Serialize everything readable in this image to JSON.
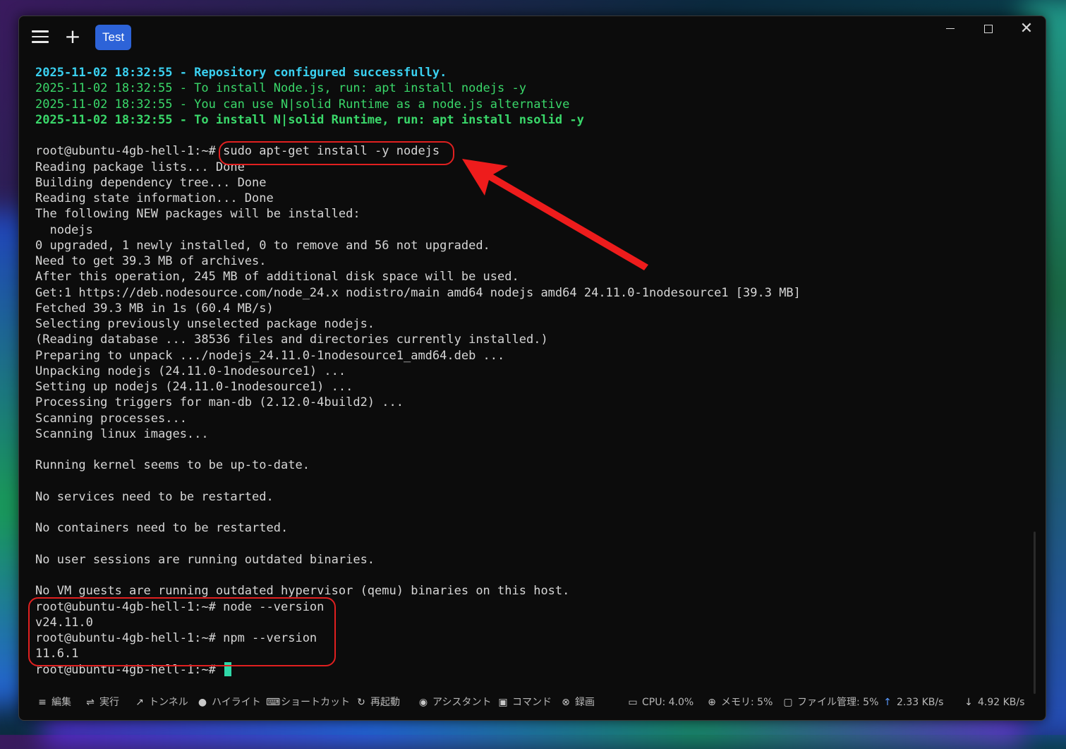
{
  "titlebar": {
    "tab_label": "Test"
  },
  "terminal": {
    "lines": [
      {
        "text": "2025-11-02 18:32:55 - Repository configured successfully.",
        "style": "c-cyan"
      },
      {
        "text": "2025-11-02 18:32:55 - To install Node.js, run: apt install nodejs -y",
        "style": "c-green"
      },
      {
        "text": "2025-11-02 18:32:55 - You can use N|solid Runtime as a node.js alternative",
        "style": "c-green"
      },
      {
        "text": "2025-11-02 18:32:55 - To install N|solid Runtime, run: apt install nsolid -y",
        "style": "c-green-b"
      },
      {
        "text": "",
        "style": ""
      },
      {
        "text": "root@ubuntu-4gb-hell-1:~# sudo apt-get install -y nodejs",
        "style": ""
      },
      {
        "text": "Reading package lists... Done",
        "style": ""
      },
      {
        "text": "Building dependency tree... Done",
        "style": ""
      },
      {
        "text": "Reading state information... Done",
        "style": ""
      },
      {
        "text": "The following NEW packages will be installed:",
        "style": ""
      },
      {
        "text": "  nodejs",
        "style": ""
      },
      {
        "text": "0 upgraded, 1 newly installed, 0 to remove and 56 not upgraded.",
        "style": ""
      },
      {
        "text": "Need to get 39.3 MB of archives.",
        "style": ""
      },
      {
        "text": "After this operation, 245 MB of additional disk space will be used.",
        "style": ""
      },
      {
        "text": "Get:1 https://deb.nodesource.com/node_24.x nodistro/main amd64 nodejs amd64 24.11.0-1nodesource1 [39.3 MB]",
        "style": ""
      },
      {
        "text": "Fetched 39.3 MB in 1s (60.4 MB/s)",
        "style": ""
      },
      {
        "text": "Selecting previously unselected package nodejs.",
        "style": ""
      },
      {
        "text": "(Reading database ... 38536 files and directories currently installed.)",
        "style": ""
      },
      {
        "text": "Preparing to unpack .../nodejs_24.11.0-1nodesource1_amd64.deb ...",
        "style": ""
      },
      {
        "text": "Unpacking nodejs (24.11.0-1nodesource1) ...",
        "style": ""
      },
      {
        "text": "Setting up nodejs (24.11.0-1nodesource1) ...",
        "style": ""
      },
      {
        "text": "Processing triggers for man-db (2.12.0-4build2) ...",
        "style": ""
      },
      {
        "text": "Scanning processes...",
        "style": ""
      },
      {
        "text": "Scanning linux images...",
        "style": ""
      },
      {
        "text": "",
        "style": ""
      },
      {
        "text": "Running kernel seems to be up-to-date.",
        "style": ""
      },
      {
        "text": "",
        "style": ""
      },
      {
        "text": "No services need to be restarted.",
        "style": ""
      },
      {
        "text": "",
        "style": ""
      },
      {
        "text": "No containers need to be restarted.",
        "style": ""
      },
      {
        "text": "",
        "style": ""
      },
      {
        "text": "No user sessions are running outdated binaries.",
        "style": ""
      },
      {
        "text": "",
        "style": ""
      },
      {
        "text": "No VM guests are running outdated hypervisor (qemu) binaries on this host.",
        "style": ""
      },
      {
        "text": "root@ubuntu-4gb-hell-1:~# node --version",
        "style": ""
      },
      {
        "text": "v24.11.0",
        "style": ""
      },
      {
        "text": "root@ubuntu-4gb-hell-1:~# npm --version",
        "style": ""
      },
      {
        "text": "11.6.1",
        "style": ""
      }
    ],
    "prompt": "root@ubuntu-4gb-hell-1:~# "
  },
  "statusbar": {
    "items": [
      {
        "label": "編集",
        "icon": "edit-icon"
      },
      {
        "label": "実行",
        "icon": "run-icon"
      },
      {
        "label": "トンネル",
        "icon": "tunnel-icon"
      },
      {
        "label": "ハイライト",
        "icon": "lightbulb-icon"
      },
      {
        "label": "ショートカット",
        "icon": "keyboard-icon"
      },
      {
        "label": "再起動",
        "icon": "restart-icon"
      },
      {
        "label": "アシスタント",
        "icon": "assistant-icon"
      },
      {
        "label": "コマンド",
        "icon": "command-icon"
      },
      {
        "label": "録画",
        "icon": "record-icon"
      }
    ],
    "cpu": "CPU: 4.0%",
    "memory": "メモリ: 5%",
    "files": "ファイル管理: 5%",
    "upload": "2.33 KB/s",
    "download": "4.92 KB/s"
  },
  "colors": {
    "tab_accent": "#2d63d8",
    "highlight_red": "#e02020",
    "cursor": "#2fd8a8",
    "log_cyan": "#3ad0f0",
    "log_green": "#3ad86a"
  }
}
